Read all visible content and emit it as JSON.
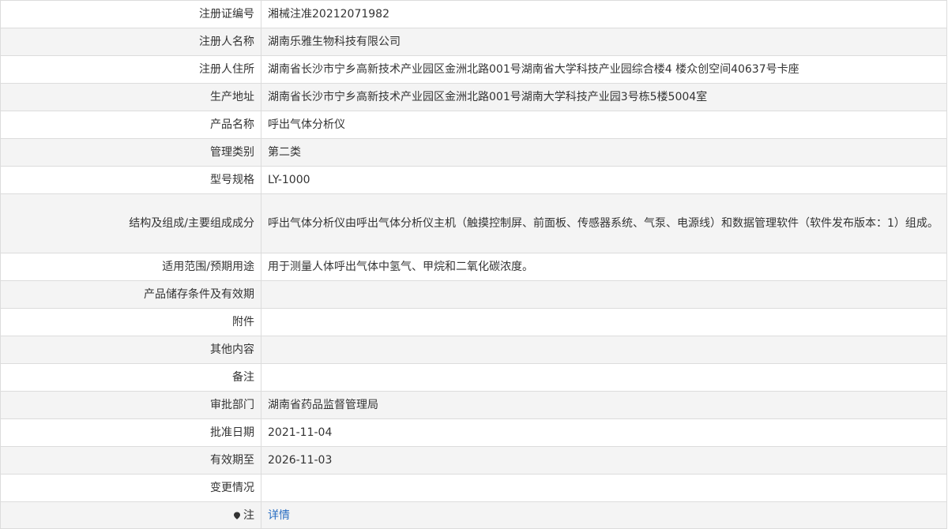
{
  "rows": [
    {
      "label": "注册证编号",
      "value": "湘械注准20212071982"
    },
    {
      "label": "注册人名称",
      "value": "湖南乐雅生物科技有限公司"
    },
    {
      "label": "注册人住所",
      "value": "湖南省长沙市宁乡高新技术产业园区金洲北路001号湖南省大学科技产业园综合楼4 楼众创空间40637号卡座"
    },
    {
      "label": "生产地址",
      "value": "湖南省长沙市宁乡高新技术产业园区金洲北路001号湖南大学科技产业园3号栋5楼5004室"
    },
    {
      "label": "产品名称",
      "value": "呼出气体分析仪"
    },
    {
      "label": "管理类别",
      "value": "第二类"
    },
    {
      "label": "型号规格",
      "value": "LY-1000"
    },
    {
      "label": "结构及组成/主要组成成分",
      "value": "呼出气体分析仪由呼出气体分析仪主机（触摸控制屏、前面板、传感器系统、气泵、电源线）和数据管理软件（软件发布版本：1）组成。"
    },
    {
      "label": "适用范围/预期用途",
      "value": "用于测量人体呼出气体中氢气、甲烷和二氧化碳浓度。"
    },
    {
      "label": "产品储存条件及有效期",
      "value": ""
    },
    {
      "label": "附件",
      "value": ""
    },
    {
      "label": "其他内容",
      "value": ""
    },
    {
      "label": "备注",
      "value": ""
    },
    {
      "label": "审批部门",
      "value": "湖南省药品监督管理局"
    },
    {
      "label": "批准日期",
      "value": "2021-11-04"
    },
    {
      "label": "有效期至",
      "value": "2026-11-03"
    },
    {
      "label": "变更情况",
      "value": ""
    }
  ],
  "note": {
    "label": "注",
    "link_text": "详情"
  },
  "colors": {
    "link": "#2a6ec2",
    "border": "#dcdcdc",
    "stripe": "#f4f4f4"
  }
}
